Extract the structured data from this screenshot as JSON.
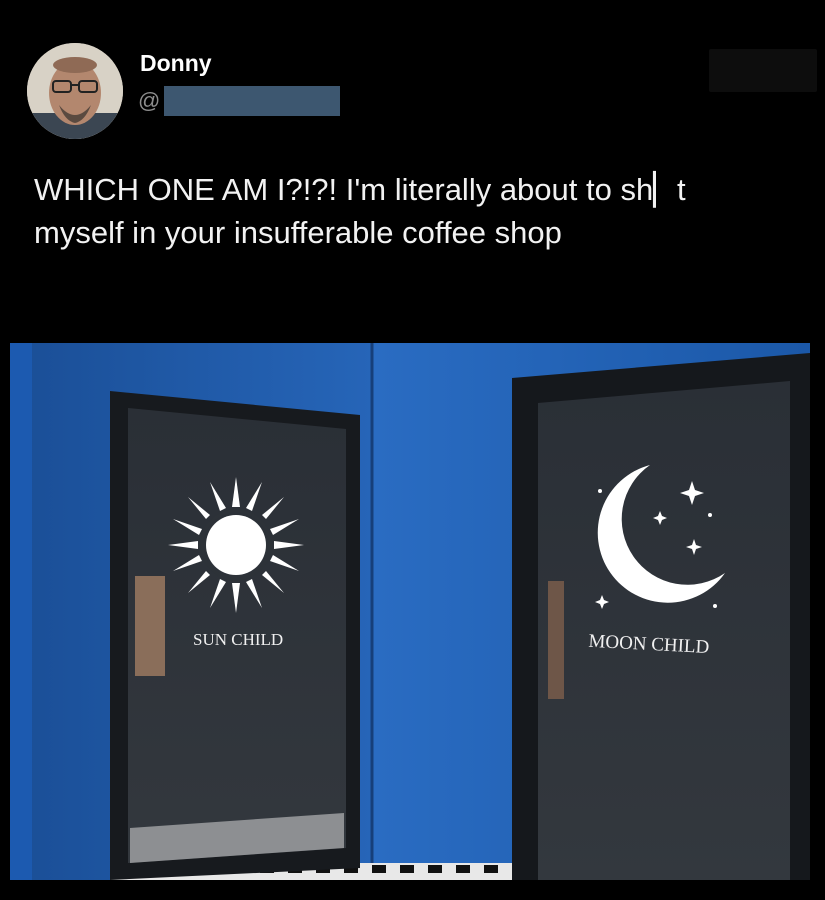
{
  "post": {
    "author_name": "Donny",
    "handle_prefix": "@",
    "tweet_text_line1": "WHICH ONE AM I?!?! I'm literally about to sh▏t",
    "tweet_text_line2": "myself in your insufferable coffee shop"
  },
  "photo": {
    "left_door_sign": "SUN CHILD",
    "right_door_sign": "MOON CHILD"
  },
  "colors": {
    "background": "#000000",
    "wall_blue": "#1f5aa8",
    "door": "#2d3238",
    "redaction": "#3d5770"
  }
}
